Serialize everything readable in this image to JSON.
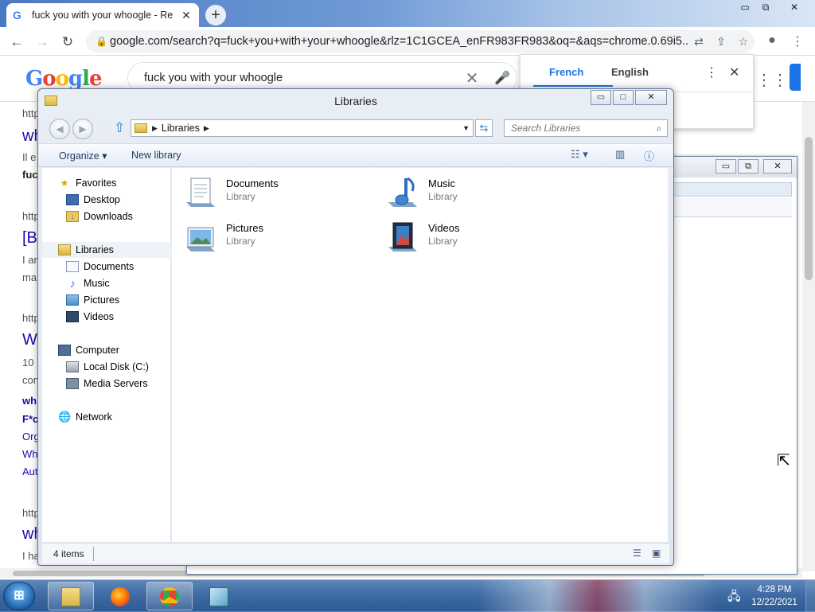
{
  "browser": {
    "tab_title": "fuck you with your whoogle - Re",
    "url": "google.com/search?q=fuck+you+with+your+whoogle&rlz=1C1GCEA_enFR983FR983&oq=&aqs=chrome.0.69i5...",
    "search_query": "fuck you with your whoogle",
    "logo": "Google",
    "translate": {
      "lang_active": "French",
      "lang_other": "English"
    },
    "results_left_fragments": [
      "http",
      "wh",
      "Il e",
      "fuc",
      "http",
      "[B",
      "I ar",
      "ma",
      "http",
      "W",
      "10",
      "con",
      "wh",
      "F*c",
      "Org",
      "Wh",
      "Aut",
      "http",
      "wh",
      "I ha"
    ]
  },
  "explorer": {
    "title": "Libraries",
    "address": "Libraries",
    "search_placeholder": "Search Libraries",
    "commands": {
      "organize": "Organize ▾",
      "new_library": "New library"
    },
    "nav": {
      "favorites": "Favorites",
      "desktop": "Desktop",
      "downloads": "Downloads",
      "libraries": "Libraries",
      "documents": "Documents",
      "music": "Music",
      "pictures": "Pictures",
      "videos": "Videos",
      "computer": "Computer",
      "local_disk": "Local Disk (C:)",
      "media_servers": "Media Servers",
      "network": "Network"
    },
    "items": [
      {
        "name": "Documents",
        "type": "Library"
      },
      {
        "name": "Music",
        "type": "Library"
      },
      {
        "name": "Pictures",
        "type": "Library"
      },
      {
        "name": "Videos",
        "type": "Library"
      }
    ],
    "status": "4 items"
  },
  "taskbar": {
    "time": "4:28 PM",
    "date": "12/22/2021"
  }
}
